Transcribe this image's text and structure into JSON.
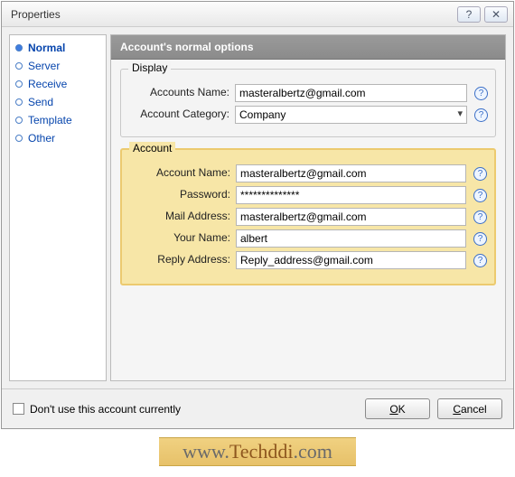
{
  "window": {
    "title": "Properties",
    "help": "?",
    "close": "✕"
  },
  "sidebar": {
    "items": [
      {
        "label": "Normal",
        "active": true
      },
      {
        "label": "Server",
        "active": false
      },
      {
        "label": "Receive",
        "active": false
      },
      {
        "label": "Send",
        "active": false
      },
      {
        "label": "Template",
        "active": false
      },
      {
        "label": "Other",
        "active": false
      }
    ]
  },
  "main": {
    "header": "Account's normal options"
  },
  "display": {
    "legend": "Display",
    "accounts_name_label": "Accounts Name:",
    "accounts_name_value": "masteralbertz@gmail.com",
    "category_label": "Account Category:",
    "category_value": "Company"
  },
  "account": {
    "legend": "Account",
    "name_label": "Account Name:",
    "name_value": "masteralbertz@gmail.com",
    "password_label": "Password:",
    "password_value": "**************",
    "mail_label": "Mail Address:",
    "mail_value": "masteralbertz@gmail.com",
    "your_name_label": "Your Name:",
    "your_name_value": "albert",
    "reply_label": "Reply Address:",
    "reply_value": "Reply_address@gmail.com"
  },
  "footer": {
    "checkbox_label": "Don't use this account currently",
    "ok": "OK",
    "ok_ul": "O",
    "ok_rest": "K",
    "cancel_ul": "C",
    "cancel_rest": "ancel"
  },
  "watermark": {
    "prefix": "www.",
    "brand": "Techddi",
    "suffix": ".com"
  }
}
